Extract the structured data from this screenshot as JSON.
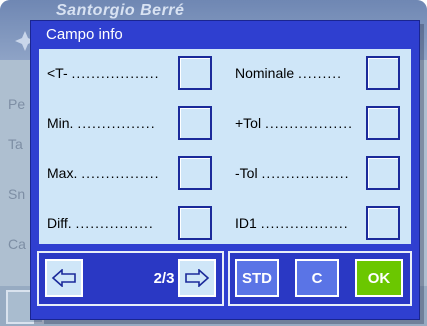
{
  "background": {
    "title": "Santorgio Berré",
    "side_letters": [
      "Pe",
      "Ta",
      "Sn",
      "Ca"
    ]
  },
  "dialog": {
    "title": "Campo info",
    "left_fields": [
      {
        "label": "<T-",
        "dots": "..................",
        "checked": false
      },
      {
        "label": "Min.",
        "dots": "................",
        "checked": false
      },
      {
        "label": "Max.",
        "dots": "................",
        "checked": false
      },
      {
        "label": "Diff.",
        "dots": "................",
        "checked": false
      }
    ],
    "right_fields": [
      {
        "label": "Nominale",
        "dots": ".........",
        "checked": false
      },
      {
        "label": "+Tol",
        "dots": "..................",
        "checked": false
      },
      {
        "label": "-Tol",
        "dots": "..................",
        "checked": false
      },
      {
        "label": "ID1",
        "dots": "..................",
        "checked": false
      }
    ],
    "footer": {
      "page_indicator": "2/3",
      "std_label": "STD",
      "clear_label": "C",
      "ok_label": "OK"
    }
  },
  "colors": {
    "dialog_bg": "#2f3fd0",
    "content_bg": "#cfe6f8",
    "ok_green": "#6bc700",
    "std_blue": "#5a74e6"
  }
}
